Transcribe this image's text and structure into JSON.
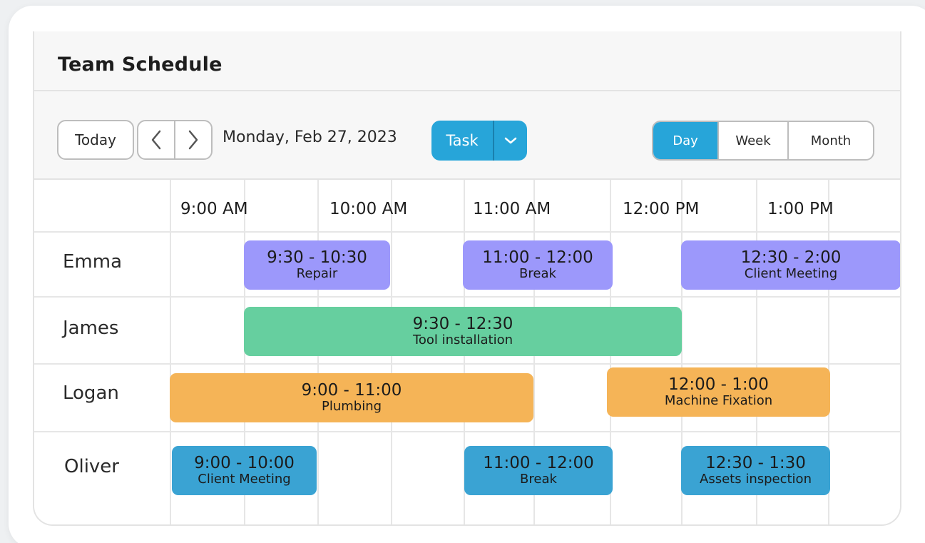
{
  "title": "Team Schedule",
  "toolbar": {
    "today_label": "Today",
    "date": "Monday, Feb 27, 2023",
    "task_label": "Task",
    "views": [
      "Day",
      "Week",
      "Month"
    ],
    "active_view": "Day"
  },
  "time_slots": [
    "9:00 AM",
    "10:00 AM",
    "11:00 AM",
    "12:00 PM",
    "1:00 PM"
  ],
  "people": [
    "Emma",
    "James",
    "Logan",
    "Oliver"
  ],
  "events": {
    "emma": [
      {
        "time": "9:30 - 10:30",
        "title": "Repair"
      },
      {
        "time": "11:00 - 12:00",
        "title": "Break"
      },
      {
        "time": "12:30 - 2:00",
        "title": "Client Meeting"
      }
    ],
    "james": [
      {
        "time": "9:30 - 12:30",
        "title": "Tool installation"
      }
    ],
    "logan": [
      {
        "time": "9:00 - 11:00",
        "title": "Plumbing"
      },
      {
        "time": "12:00 - 1:00",
        "title": "Machine Fixation"
      }
    ],
    "oliver": [
      {
        "time": "9:00 - 10:00",
        "title": "Client Meeting"
      },
      {
        "time": "11:00 - 12:00",
        "title": "Break"
      },
      {
        "time": "12:30 - 1:30",
        "title": "Assets inspection"
      }
    ]
  },
  "colors": {
    "accent": "#27a5d9",
    "emma": "#9c98fb",
    "james": "#66cf9f",
    "logan": "#f5b457",
    "oliver": "#3aa3d3"
  }
}
